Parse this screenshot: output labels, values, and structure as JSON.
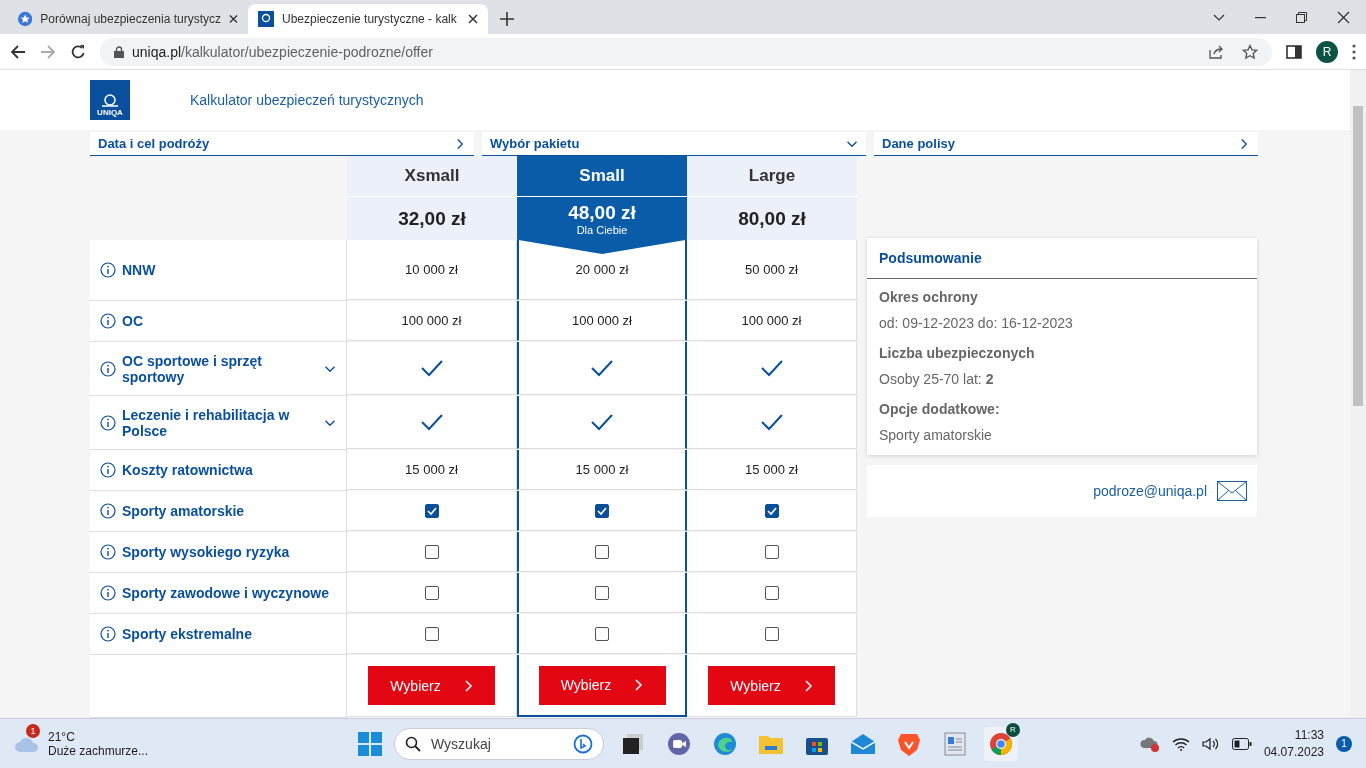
{
  "browser": {
    "tabs": [
      {
        "title": "Porównaj ubezpieczenia turystycz",
        "selected": false
      },
      {
        "title": "Ubezpieczenie turystyczne - kalk",
        "selected": true
      }
    ],
    "url_host": "uniqa.pl",
    "url_path": "/kalkulator/ubezpieczenie-podrozne/offer",
    "profile": "R"
  },
  "header": {
    "logo": "UNIQA",
    "title": "Kalkulator ubezpieczeń turystycznych"
  },
  "steps": [
    {
      "label": "Data i cel podróży",
      "expanded": false
    },
    {
      "label": "Wybór pakietu",
      "expanded": true
    },
    {
      "label": "Dane polisy",
      "expanded": false
    }
  ],
  "plans": [
    {
      "name": "Xsmall",
      "price": "32,00 zł",
      "selected": false,
      "button": "Wybierz"
    },
    {
      "name": "Small",
      "price": "48,00 zł",
      "note": "Dla Ciebie",
      "selected": true,
      "button": "Wybierz"
    },
    {
      "name": "Large",
      "price": "80,00 zł",
      "selected": false,
      "button": "Wybierz"
    }
  ],
  "rows": [
    {
      "label": "NNW",
      "kind": "value",
      "expandable": false,
      "cells": [
        "10 000 zł",
        "20 000 zł",
        "50 000 zł"
      ]
    },
    {
      "label": "OC",
      "kind": "value",
      "expandable": false,
      "cells": [
        "100 000 zł",
        "100 000 zł",
        "100 000 zł"
      ]
    },
    {
      "label": "OC sportowe i sprzęt sportowy",
      "kind": "included",
      "expandable": true,
      "cells": [
        {
          "included": true
        },
        {
          "included": true
        },
        {
          "included": true
        }
      ]
    },
    {
      "label": "Leczenie i rehabilitacja w Polsce",
      "kind": "included",
      "expandable": true,
      "cells": [
        {
          "included": true
        },
        {
          "included": true
        },
        {
          "included": true
        }
      ]
    },
    {
      "label": "Koszty ratownictwa",
      "kind": "value",
      "expandable": false,
      "cells": [
        "15 000 zł",
        "15 000 zł",
        "15 000 zł"
      ]
    },
    {
      "label": "Sporty amatorskie",
      "kind": "checkbox",
      "expandable": false,
      "cells": [
        {
          "checked": true
        },
        {
          "checked": true
        },
        {
          "checked": true
        }
      ]
    },
    {
      "label": "Sporty wysokiego ryzyka",
      "kind": "checkbox",
      "expandable": false,
      "cells": [
        {
          "checked": false
        },
        {
          "checked": false
        },
        {
          "checked": false
        }
      ]
    },
    {
      "label": "Sporty zawodowe i wyczynowe",
      "kind": "checkbox",
      "expandable": false,
      "cells": [
        {
          "checked": false
        },
        {
          "checked": false
        },
        {
          "checked": false
        }
      ]
    },
    {
      "label": "Sporty ekstremalne",
      "kind": "checkbox",
      "expandable": false,
      "cells": [
        {
          "checked": false
        },
        {
          "checked": false
        },
        {
          "checked": false
        }
      ]
    }
  ],
  "summary": {
    "title": "Podsumowanie",
    "sections": [
      {
        "heading": "Okres ochrony",
        "text": "od: 09-12-2023 do: 16-12-2023"
      },
      {
        "heading": "Liczba ubezpieczonych",
        "text": "Osoby 25-70 lat: **2**"
      },
      {
        "heading": "Opcje dodatkowe:",
        "text": "Sporty amatorskie"
      }
    ]
  },
  "contact": {
    "email": "podroze@uniqa.pl"
  },
  "taskbar": {
    "weather_badge": "1",
    "temperature": "21°C",
    "weather": "Duże zachmurze...",
    "search_placeholder": "Wyszukaj",
    "chrome_profile": "R",
    "time": "11:33",
    "date": "04.07.2023",
    "notifications": "1"
  }
}
